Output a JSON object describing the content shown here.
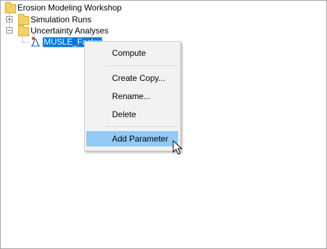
{
  "tree": {
    "root_label": "Erosion Modeling Workshop",
    "simulation_runs_label": "Simulation Runs",
    "uncertainty_analyses_label": "Uncertainty Analyses",
    "selected_item_label": "MUSLE_Factor",
    "expand_symbol": "+",
    "collapse_symbol": "−"
  },
  "context_menu": {
    "compute_label": "Compute",
    "create_copy_label": "Create Copy...",
    "rename_label": "Rename...",
    "delete_label": "Delete",
    "add_parameter_label": "Add Parameter",
    "highlighted_item": "Add Parameter"
  },
  "colors": {
    "selection_blue": "#0078d7",
    "menu_hover": "#91c9f7",
    "folder_yellow": "#f4cf6c"
  }
}
